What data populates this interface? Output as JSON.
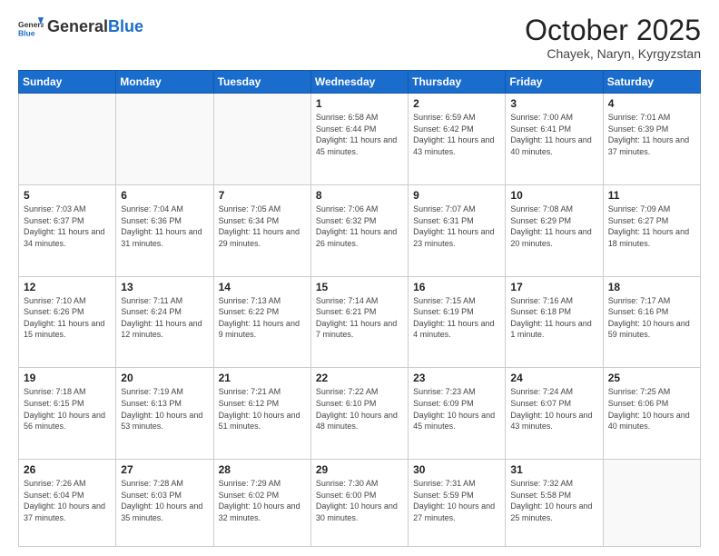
{
  "header": {
    "logo_line1": "General",
    "logo_line2": "Blue",
    "month": "October 2025",
    "location": "Chayek, Naryn, Kyrgyzstan"
  },
  "weekdays": [
    "Sunday",
    "Monday",
    "Tuesday",
    "Wednesday",
    "Thursday",
    "Friday",
    "Saturday"
  ],
  "weeks": [
    [
      {
        "day": "",
        "sunrise": "",
        "sunset": "",
        "daylight": ""
      },
      {
        "day": "",
        "sunrise": "",
        "sunset": "",
        "daylight": ""
      },
      {
        "day": "",
        "sunrise": "",
        "sunset": "",
        "daylight": ""
      },
      {
        "day": "1",
        "sunrise": "Sunrise: 6:58 AM",
        "sunset": "Sunset: 6:44 PM",
        "daylight": "Daylight: 11 hours and 45 minutes."
      },
      {
        "day": "2",
        "sunrise": "Sunrise: 6:59 AM",
        "sunset": "Sunset: 6:42 PM",
        "daylight": "Daylight: 11 hours and 43 minutes."
      },
      {
        "day": "3",
        "sunrise": "Sunrise: 7:00 AM",
        "sunset": "Sunset: 6:41 PM",
        "daylight": "Daylight: 11 hours and 40 minutes."
      },
      {
        "day": "4",
        "sunrise": "Sunrise: 7:01 AM",
        "sunset": "Sunset: 6:39 PM",
        "daylight": "Daylight: 11 hours and 37 minutes."
      }
    ],
    [
      {
        "day": "5",
        "sunrise": "Sunrise: 7:03 AM",
        "sunset": "Sunset: 6:37 PM",
        "daylight": "Daylight: 11 hours and 34 minutes."
      },
      {
        "day": "6",
        "sunrise": "Sunrise: 7:04 AM",
        "sunset": "Sunset: 6:36 PM",
        "daylight": "Daylight: 11 hours and 31 minutes."
      },
      {
        "day": "7",
        "sunrise": "Sunrise: 7:05 AM",
        "sunset": "Sunset: 6:34 PM",
        "daylight": "Daylight: 11 hours and 29 minutes."
      },
      {
        "day": "8",
        "sunrise": "Sunrise: 7:06 AM",
        "sunset": "Sunset: 6:32 PM",
        "daylight": "Daylight: 11 hours and 26 minutes."
      },
      {
        "day": "9",
        "sunrise": "Sunrise: 7:07 AM",
        "sunset": "Sunset: 6:31 PM",
        "daylight": "Daylight: 11 hours and 23 minutes."
      },
      {
        "day": "10",
        "sunrise": "Sunrise: 7:08 AM",
        "sunset": "Sunset: 6:29 PM",
        "daylight": "Daylight: 11 hours and 20 minutes."
      },
      {
        "day": "11",
        "sunrise": "Sunrise: 7:09 AM",
        "sunset": "Sunset: 6:27 PM",
        "daylight": "Daylight: 11 hours and 18 minutes."
      }
    ],
    [
      {
        "day": "12",
        "sunrise": "Sunrise: 7:10 AM",
        "sunset": "Sunset: 6:26 PM",
        "daylight": "Daylight: 11 hours and 15 minutes."
      },
      {
        "day": "13",
        "sunrise": "Sunrise: 7:11 AM",
        "sunset": "Sunset: 6:24 PM",
        "daylight": "Daylight: 11 hours and 12 minutes."
      },
      {
        "day": "14",
        "sunrise": "Sunrise: 7:13 AM",
        "sunset": "Sunset: 6:22 PM",
        "daylight": "Daylight: 11 hours and 9 minutes."
      },
      {
        "day": "15",
        "sunrise": "Sunrise: 7:14 AM",
        "sunset": "Sunset: 6:21 PM",
        "daylight": "Daylight: 11 hours and 7 minutes."
      },
      {
        "day": "16",
        "sunrise": "Sunrise: 7:15 AM",
        "sunset": "Sunset: 6:19 PM",
        "daylight": "Daylight: 11 hours and 4 minutes."
      },
      {
        "day": "17",
        "sunrise": "Sunrise: 7:16 AM",
        "sunset": "Sunset: 6:18 PM",
        "daylight": "Daylight: 11 hours and 1 minute."
      },
      {
        "day": "18",
        "sunrise": "Sunrise: 7:17 AM",
        "sunset": "Sunset: 6:16 PM",
        "daylight": "Daylight: 10 hours and 59 minutes."
      }
    ],
    [
      {
        "day": "19",
        "sunrise": "Sunrise: 7:18 AM",
        "sunset": "Sunset: 6:15 PM",
        "daylight": "Daylight: 10 hours and 56 minutes."
      },
      {
        "day": "20",
        "sunrise": "Sunrise: 7:19 AM",
        "sunset": "Sunset: 6:13 PM",
        "daylight": "Daylight: 10 hours and 53 minutes."
      },
      {
        "day": "21",
        "sunrise": "Sunrise: 7:21 AM",
        "sunset": "Sunset: 6:12 PM",
        "daylight": "Daylight: 10 hours and 51 minutes."
      },
      {
        "day": "22",
        "sunrise": "Sunrise: 7:22 AM",
        "sunset": "Sunset: 6:10 PM",
        "daylight": "Daylight: 10 hours and 48 minutes."
      },
      {
        "day": "23",
        "sunrise": "Sunrise: 7:23 AM",
        "sunset": "Sunset: 6:09 PM",
        "daylight": "Daylight: 10 hours and 45 minutes."
      },
      {
        "day": "24",
        "sunrise": "Sunrise: 7:24 AM",
        "sunset": "Sunset: 6:07 PM",
        "daylight": "Daylight: 10 hours and 43 minutes."
      },
      {
        "day": "25",
        "sunrise": "Sunrise: 7:25 AM",
        "sunset": "Sunset: 6:06 PM",
        "daylight": "Daylight: 10 hours and 40 minutes."
      }
    ],
    [
      {
        "day": "26",
        "sunrise": "Sunrise: 7:26 AM",
        "sunset": "Sunset: 6:04 PM",
        "daylight": "Daylight: 10 hours and 37 minutes."
      },
      {
        "day": "27",
        "sunrise": "Sunrise: 7:28 AM",
        "sunset": "Sunset: 6:03 PM",
        "daylight": "Daylight: 10 hours and 35 minutes."
      },
      {
        "day": "28",
        "sunrise": "Sunrise: 7:29 AM",
        "sunset": "Sunset: 6:02 PM",
        "daylight": "Daylight: 10 hours and 32 minutes."
      },
      {
        "day": "29",
        "sunrise": "Sunrise: 7:30 AM",
        "sunset": "Sunset: 6:00 PM",
        "daylight": "Daylight: 10 hours and 30 minutes."
      },
      {
        "day": "30",
        "sunrise": "Sunrise: 7:31 AM",
        "sunset": "Sunset: 5:59 PM",
        "daylight": "Daylight: 10 hours and 27 minutes."
      },
      {
        "day": "31",
        "sunrise": "Sunrise: 7:32 AM",
        "sunset": "Sunset: 5:58 PM",
        "daylight": "Daylight: 10 hours and 25 minutes."
      },
      {
        "day": "",
        "sunrise": "",
        "sunset": "",
        "daylight": ""
      }
    ]
  ]
}
